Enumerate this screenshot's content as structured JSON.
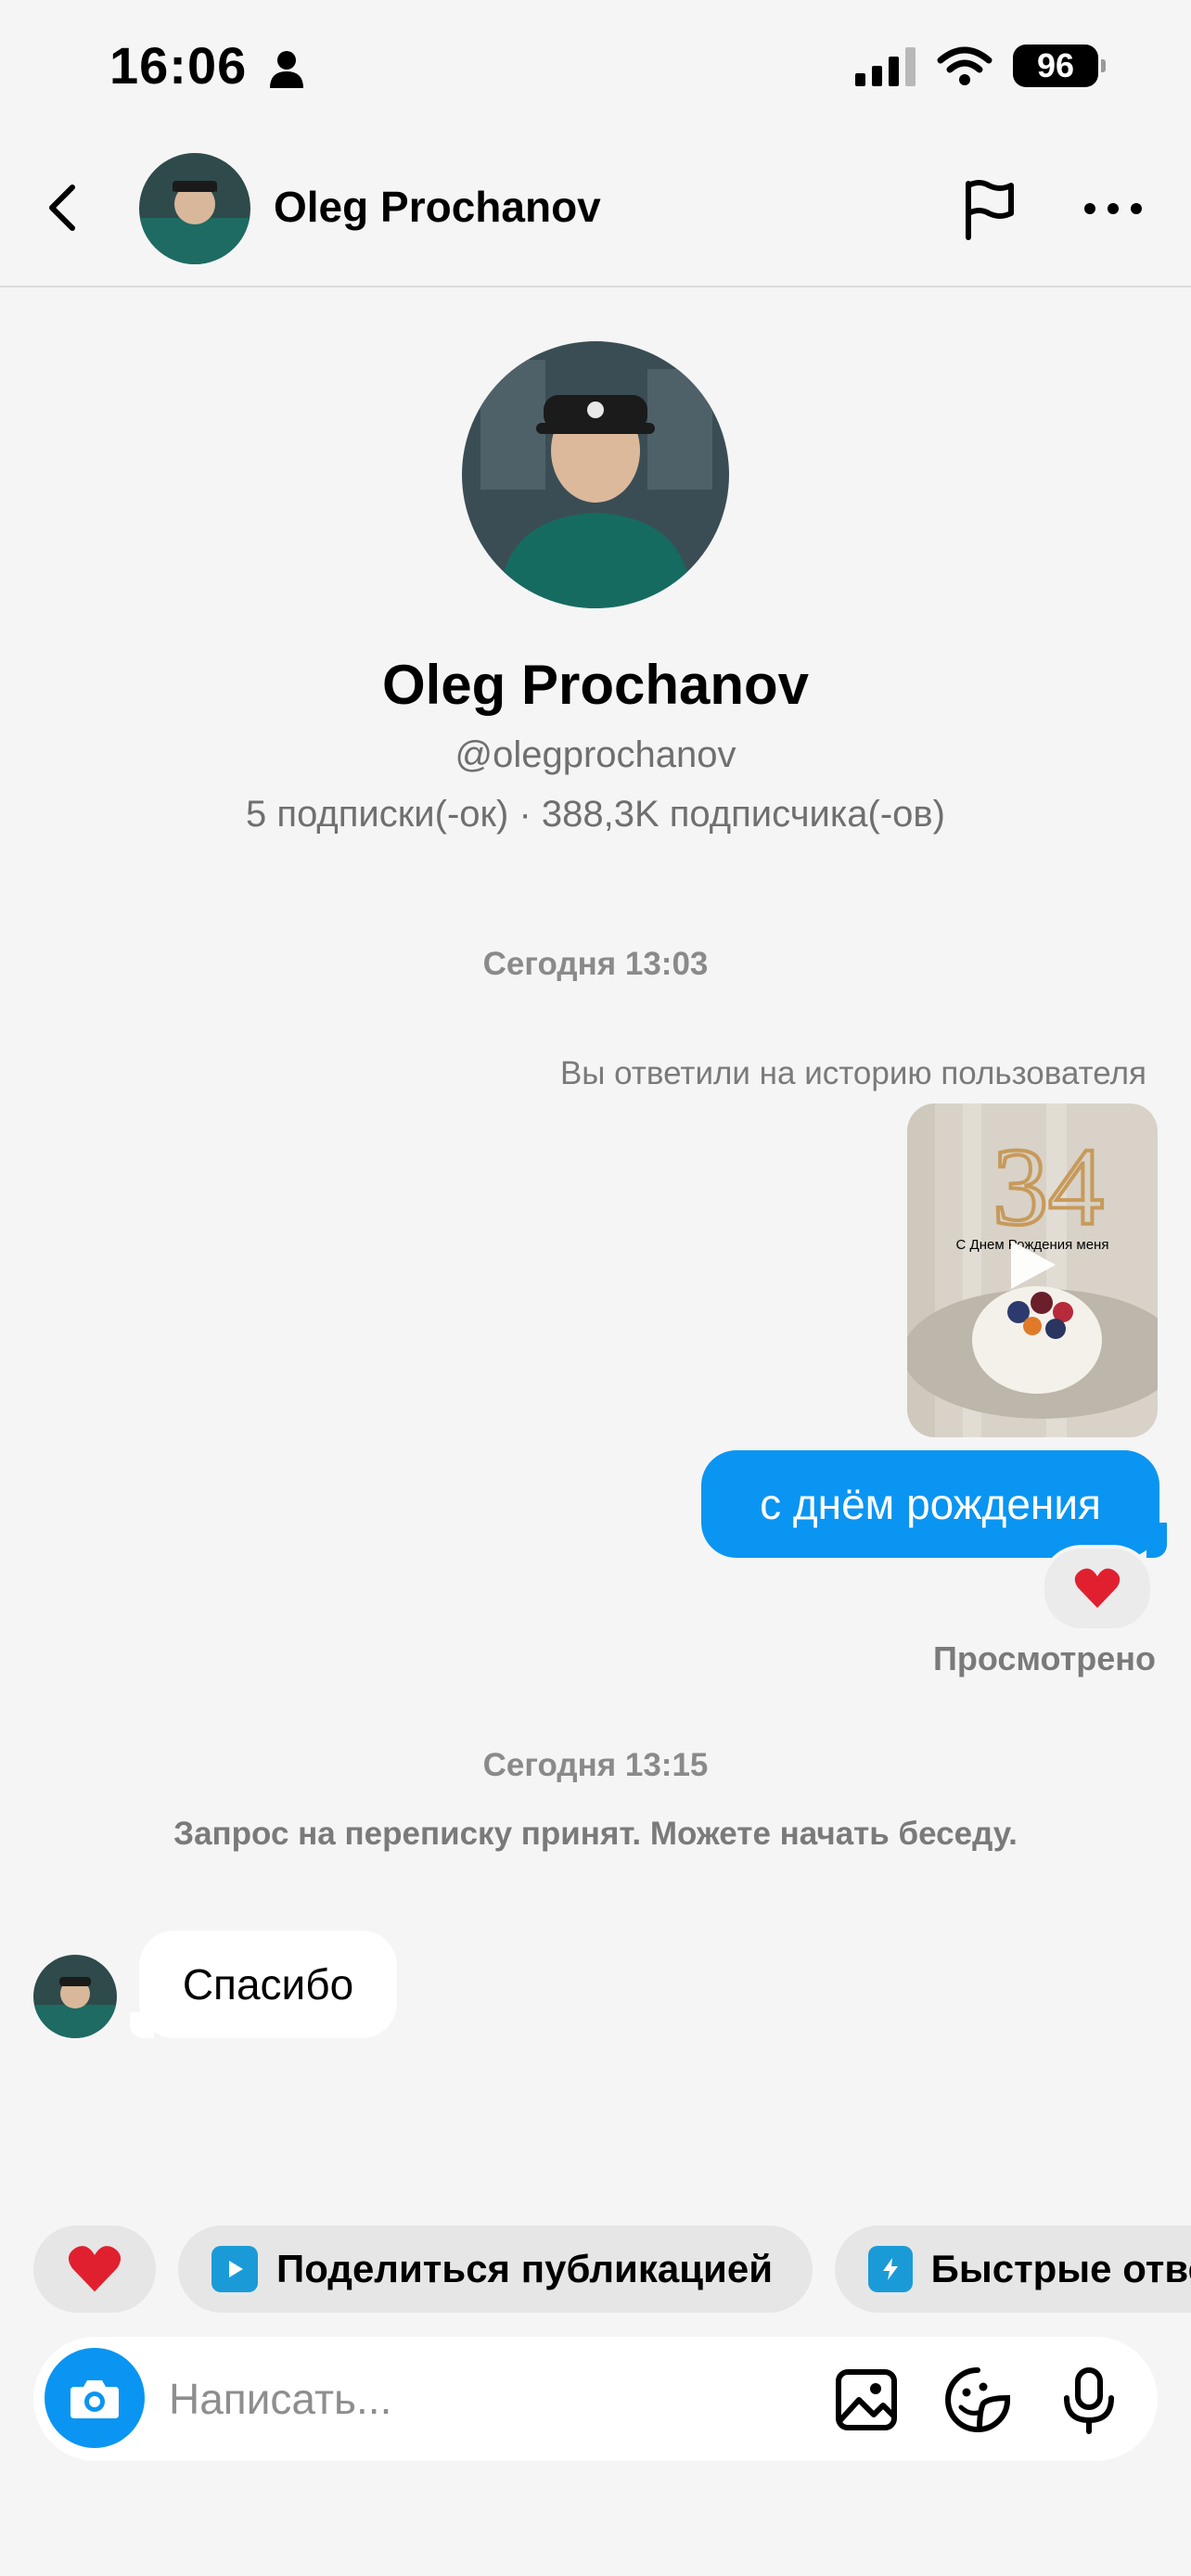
{
  "status_bar": {
    "time": "16:06",
    "battery": "96"
  },
  "header": {
    "name": "Oleg Prochanov"
  },
  "profile": {
    "name": "Oleg Prochanov",
    "handle": "@olegprochanov",
    "stats": "5 подписки(-ок) · 388,3K подписчика(-ов)"
  },
  "thread": {
    "date1": "Сегодня 13:03",
    "story_reply_note": "Вы ответили на историю пользователя",
    "story_caption": "С Днем Рождения меня",
    "story_number": "34",
    "outgoing_message": "с днём рождения",
    "reaction": "❤️",
    "seen": "Просмотрено",
    "date2": "Сегодня 13:15",
    "request_accepted": "Запрос на переписку принят. Можете начать беседу.",
    "incoming_message": "Спасибо"
  },
  "quick_actions": {
    "heart": "❤️",
    "share_post": "Поделиться публикацией",
    "quick_replies": "Быстрые отве"
  },
  "composer": {
    "placeholder": "Написать..."
  },
  "colors": {
    "accent": "#0a95f2",
    "background": "#f5f5f5"
  }
}
